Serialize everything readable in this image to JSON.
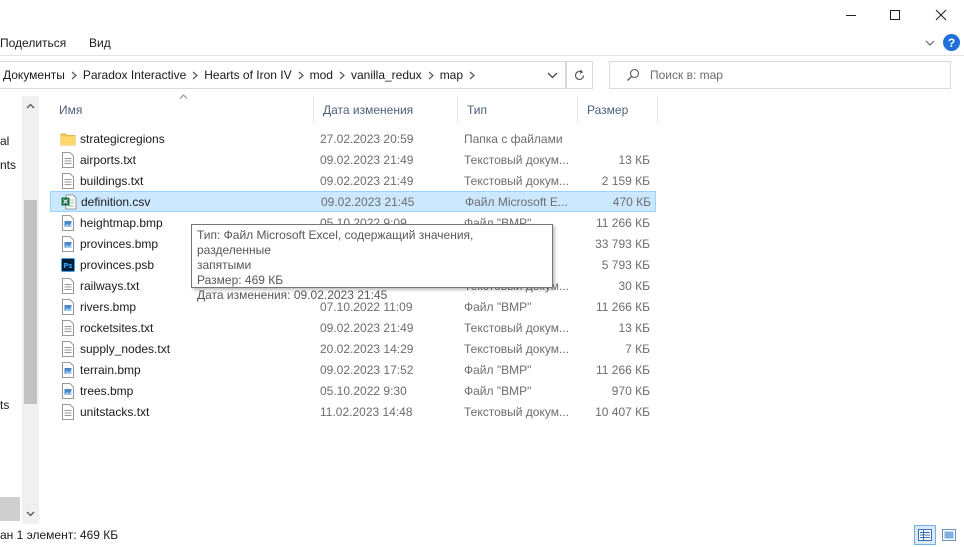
{
  "ribbon": {
    "share_label": "Поделиться",
    "view_label": "Вид",
    "help_label": "?"
  },
  "address": {
    "crumbs": [
      "Документы",
      "Paradox Interactive",
      "Hearts of Iron IV",
      "mod",
      "vanilla_redux",
      "map"
    ]
  },
  "search": {
    "placeholder": "Поиск в: map"
  },
  "nav": {
    "fragments": [
      "al",
      "nts",
      "ts"
    ]
  },
  "columns": {
    "name": "Имя",
    "date": "Дата изменения",
    "type": "Тип",
    "size": "Размер"
  },
  "files": [
    {
      "icon": "folder-icon",
      "name": "strategicregions",
      "date": "27.02.2023 20:59",
      "type": "Папка с файлами",
      "size": ""
    },
    {
      "icon": "text-file-icon",
      "name": "airports.txt",
      "date": "09.02.2023 21:49",
      "type": "Текстовый докум...",
      "size": "13 КБ"
    },
    {
      "icon": "text-file-icon",
      "name": "buildings.txt",
      "date": "09.02.2023 21:49",
      "type": "Текстовый докум...",
      "size": "2 159 КБ"
    },
    {
      "icon": "excel-file-icon",
      "name": "definition.csv",
      "date": "09.02.2023 21:45",
      "type": "Файл Microsoft E...",
      "size": "470 КБ"
    },
    {
      "icon": "bmp-file-icon",
      "name": "heightmap.bmp",
      "date": "05.10.2022 9:09",
      "type": "Файл \"BMP\"",
      "size": "11 266 КБ"
    },
    {
      "icon": "bmp-file-icon",
      "name": "provinces.bmp",
      "date": "",
      "type": "",
      "size": "33 793 КБ"
    },
    {
      "icon": "photoshop-file-icon",
      "name": "provinces.psb",
      "date": "",
      "type": "",
      "size": "5 793 КБ"
    },
    {
      "icon": "text-file-icon",
      "name": "railways.txt",
      "date": "",
      "type": "Текстовый докум...",
      "size": "30 КБ"
    },
    {
      "icon": "bmp-file-icon",
      "name": "rivers.bmp",
      "date": "07.10.2022 11:09",
      "type": "Файл \"BMP\"",
      "size": "11 266 КБ"
    },
    {
      "icon": "text-file-icon",
      "name": "rocketsites.txt",
      "date": "09.02.2023 21:49",
      "type": "Текстовый докум...",
      "size": "13 КБ"
    },
    {
      "icon": "text-file-icon",
      "name": "supply_nodes.txt",
      "date": "20.02.2023 14:29",
      "type": "Текстовый докум...",
      "size": "7 КБ"
    },
    {
      "icon": "bmp-file-icon",
      "name": "terrain.bmp",
      "date": "09.02.2023 17:52",
      "type": "Файл \"BMP\"",
      "size": "11 266 КБ"
    },
    {
      "icon": "bmp-file-icon",
      "name": "trees.bmp",
      "date": "05.10.2022 9:30",
      "type": "Файл \"BMP\"",
      "size": "970 КБ"
    },
    {
      "icon": "text-file-icon",
      "name": "unitstacks.txt",
      "date": "11.02.2023 14:48",
      "type": "Текстовый докум...",
      "size": "10 407 КБ"
    }
  ],
  "selected_index": 3,
  "tooltip": {
    "type_line": "Тип: Файл Microsoft Excel, содержащий значения, разделенные",
    "type_line2": "запятыми",
    "size_line": "Размер: 469 КБ",
    "date_line": "Дата изменения: 09.02.2023 21:45"
  },
  "status": {
    "text": "ан 1 элемент: 469 КБ"
  },
  "colors": {
    "selection_bg": "#cce8ff",
    "selection_border": "#99d1ff",
    "header_text": "#4c607a",
    "folder": "#f5c85a",
    "excel": "#1d7044",
    "photoshop": "#001e36"
  }
}
